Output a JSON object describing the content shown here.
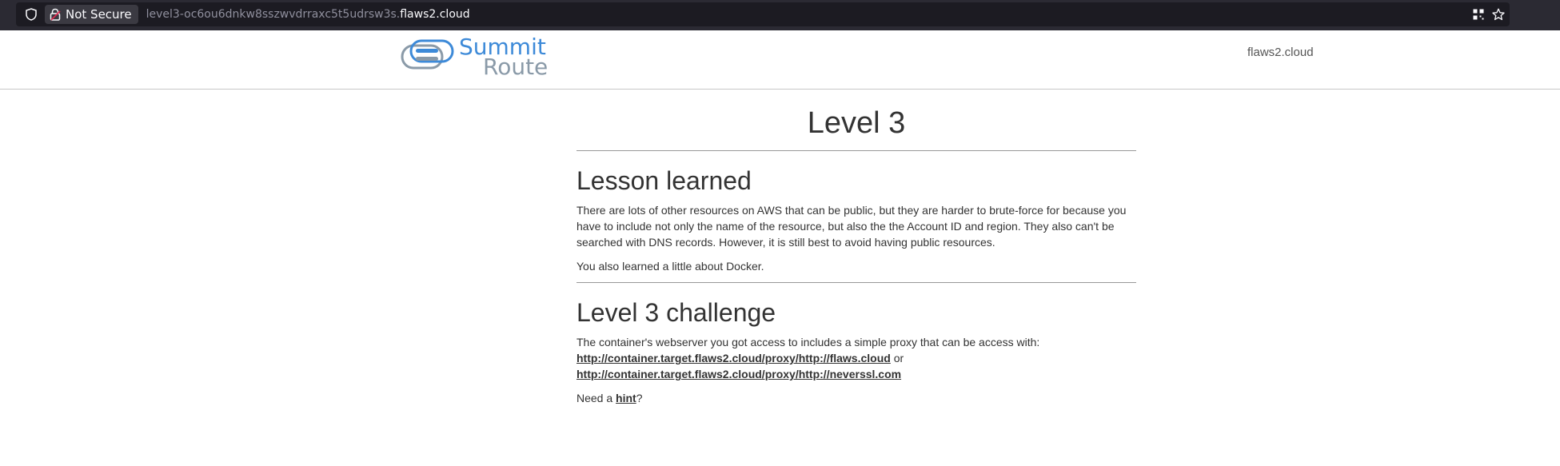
{
  "browser": {
    "security_label": "Not Secure",
    "url_prefix": "level3-oc6ou6dnkw8sszwvdrraxc5t5udrsw3s.",
    "url_domain": "flaws2.cloud",
    "icons": [
      "shield-icon",
      "lock-warning-icon",
      "qr-code-icon",
      "star-icon"
    ]
  },
  "header": {
    "logo_line1": "Summit",
    "logo_line2": "Route",
    "nav_link": "flaws2.cloud"
  },
  "main": {
    "title": "Level 3",
    "lesson": {
      "heading": "Lesson learned",
      "paragraph1": "There are lots of other resources on AWS that can be public, but they are harder to brute-force for because you have to include not only the name of the resource, but also the the Account ID and region. They also can't be searched with DNS records. However, it is still best to avoid having public resources.",
      "paragraph2": "You also learned a little about Docker."
    },
    "challenge": {
      "heading": "Level 3 challenge",
      "intro": "The container's webserver you got access to includes a simple proxy that can be access with: ",
      "link1": "http://container.target.flaws2.cloud/proxy/http://flaws.cloud",
      "or_text": " or ",
      "link2": "http://container.target.flaws2.cloud/proxy/http://neverssl.com",
      "hint_prefix": "Need a ",
      "hint_link": "hint",
      "hint_suffix": "?"
    }
  },
  "colors": {
    "chrome_bg": "#2b2a33",
    "urlbar_bg": "#1c1b22",
    "logo_blue": "#3d8ad8",
    "logo_gray": "#8a9aa8",
    "text": "#333333"
  }
}
